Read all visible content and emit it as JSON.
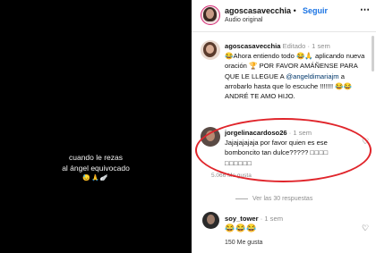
{
  "video": {
    "caption_line1": "cuando le rezas",
    "caption_line2": "al ángel equivocado",
    "caption_emoji": "😓🙏🪽"
  },
  "header": {
    "username": "agoscasavecchia",
    "separator": "•",
    "follow_label": "Seguir",
    "audio_label": "Audio original",
    "more_icon": "⋯"
  },
  "comments": [
    {
      "username": "agoscasavecchia",
      "edited": "Editado",
      "time": "1 sem",
      "text_before_mention": "😂Ahora entiendo todo 😂🙏 aplicando nueva oración 🏆 POR FAVOR AMÁÑENSE PARA QUE LE LLEGUE A ",
      "mention": "@angeldimariajm",
      "text_after_mention": " a arrobarlo hasta que lo escuche !!!!!!! 😂😂 ANDRÉ TE AMO HIJO."
    },
    {
      "username": "jorgelinacardoso26",
      "time": "1 sem",
      "text": "Jajajajajaja por favor quien es ese bomboncito tan dulce????? ",
      "boxes": "□□□□ □□□□□□",
      "likes": "5.066 Me gusta"
    },
    {
      "username": "soy_tower",
      "time": "1 sem",
      "text": "😂😂😂"
    }
  ],
  "replies_label": "Ver las 30 respuestas",
  "footer_likes": "150 Me gusta",
  "icons": {
    "heart": "♡",
    "more": "⋯"
  },
  "colors": {
    "follow": "#1b74e4",
    "highlight_ellipse": "#e0252b"
  }
}
